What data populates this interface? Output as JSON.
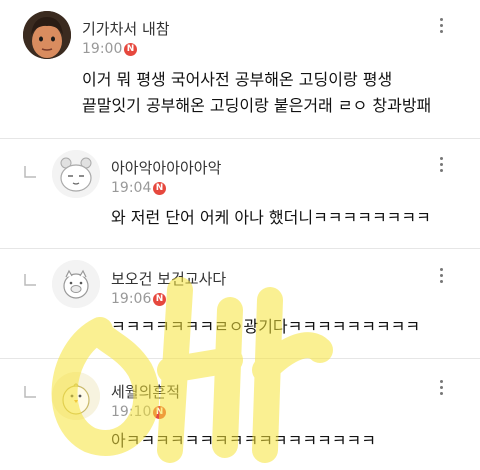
{
  "comments": [
    {
      "author": "기가차서 내참",
      "time": "19:00",
      "badge": "N",
      "avatar": "cartoon-face-icon",
      "lines": [
        "이거 뭐 평생 국어사전 공부해온 고딩이랑 평생",
        "끝말잇기 공부해온 고딩이랑 붙은거래 ㄹㅇ 창과방패"
      ]
    },
    {
      "author": "아아악아아아아악",
      "time": "19:04",
      "badge": "N",
      "avatar": "hamster-icon",
      "lines": [
        "와 저런 단어 어케 아나 했더니ㅋㅋㅋㅋㅋㅋㅋㅋ"
      ]
    },
    {
      "author": "보오건 보건교사다",
      "time": "19:06",
      "badge": "N",
      "avatar": "pig-icon",
      "lines": [
        "ㅋㅋㅋㅋㅋㅋㅋㄹㅇ광기다ㅋㅋㅋㅋㅋㅋㅋㅋㅋ"
      ]
    },
    {
      "author": "세월의흔적",
      "time": "19:10",
      "badge": "N",
      "avatar": "chick-icon",
      "lines": [
        "아ㅋㅋㅋㅋㅋㅋㅋㅋㅋㅋㅋㅋㅋㅋㅋㅋㅋ"
      ]
    }
  ],
  "colors": {
    "badge": "#e6483e",
    "watermark": "#f7e43a",
    "divider": "#e6e6e6"
  }
}
